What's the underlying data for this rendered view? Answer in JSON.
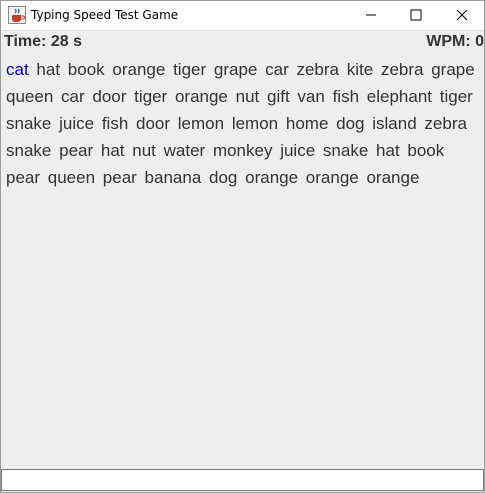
{
  "window": {
    "title": "Typing Speed Test Game"
  },
  "status": {
    "time_text": "Time: 28 s",
    "wpm_text": "WPM: 0"
  },
  "words": [
    "cat",
    "hat",
    "book",
    "orange",
    "tiger",
    "grape",
    "car",
    "zebra",
    "kite",
    "zebra",
    "grape",
    "queen",
    "car",
    "door",
    "tiger",
    "orange",
    "nut",
    "gift",
    "van",
    "fish",
    "elephant",
    "tiger",
    "snake",
    "juice",
    "fish",
    "door",
    "lemon",
    "lemon",
    "home",
    "dog",
    "island",
    "zebra",
    "snake",
    "pear",
    "hat",
    "nut",
    "water",
    "monkey",
    "juice",
    "snake",
    "hat",
    "book",
    "pear",
    "queen",
    "pear",
    "banana",
    "dog",
    "orange",
    "orange",
    "orange"
  ],
  "current_word_index": 0,
  "input": {
    "value": "",
    "placeholder": ""
  },
  "colors": {
    "current_word": "#0000cc",
    "text": "#333333",
    "background": "#eeeeee"
  },
  "icons": {
    "app": "java-coffee-cup-icon",
    "minimize": "minimize-icon",
    "maximize": "maximize-icon",
    "close": "close-icon"
  }
}
